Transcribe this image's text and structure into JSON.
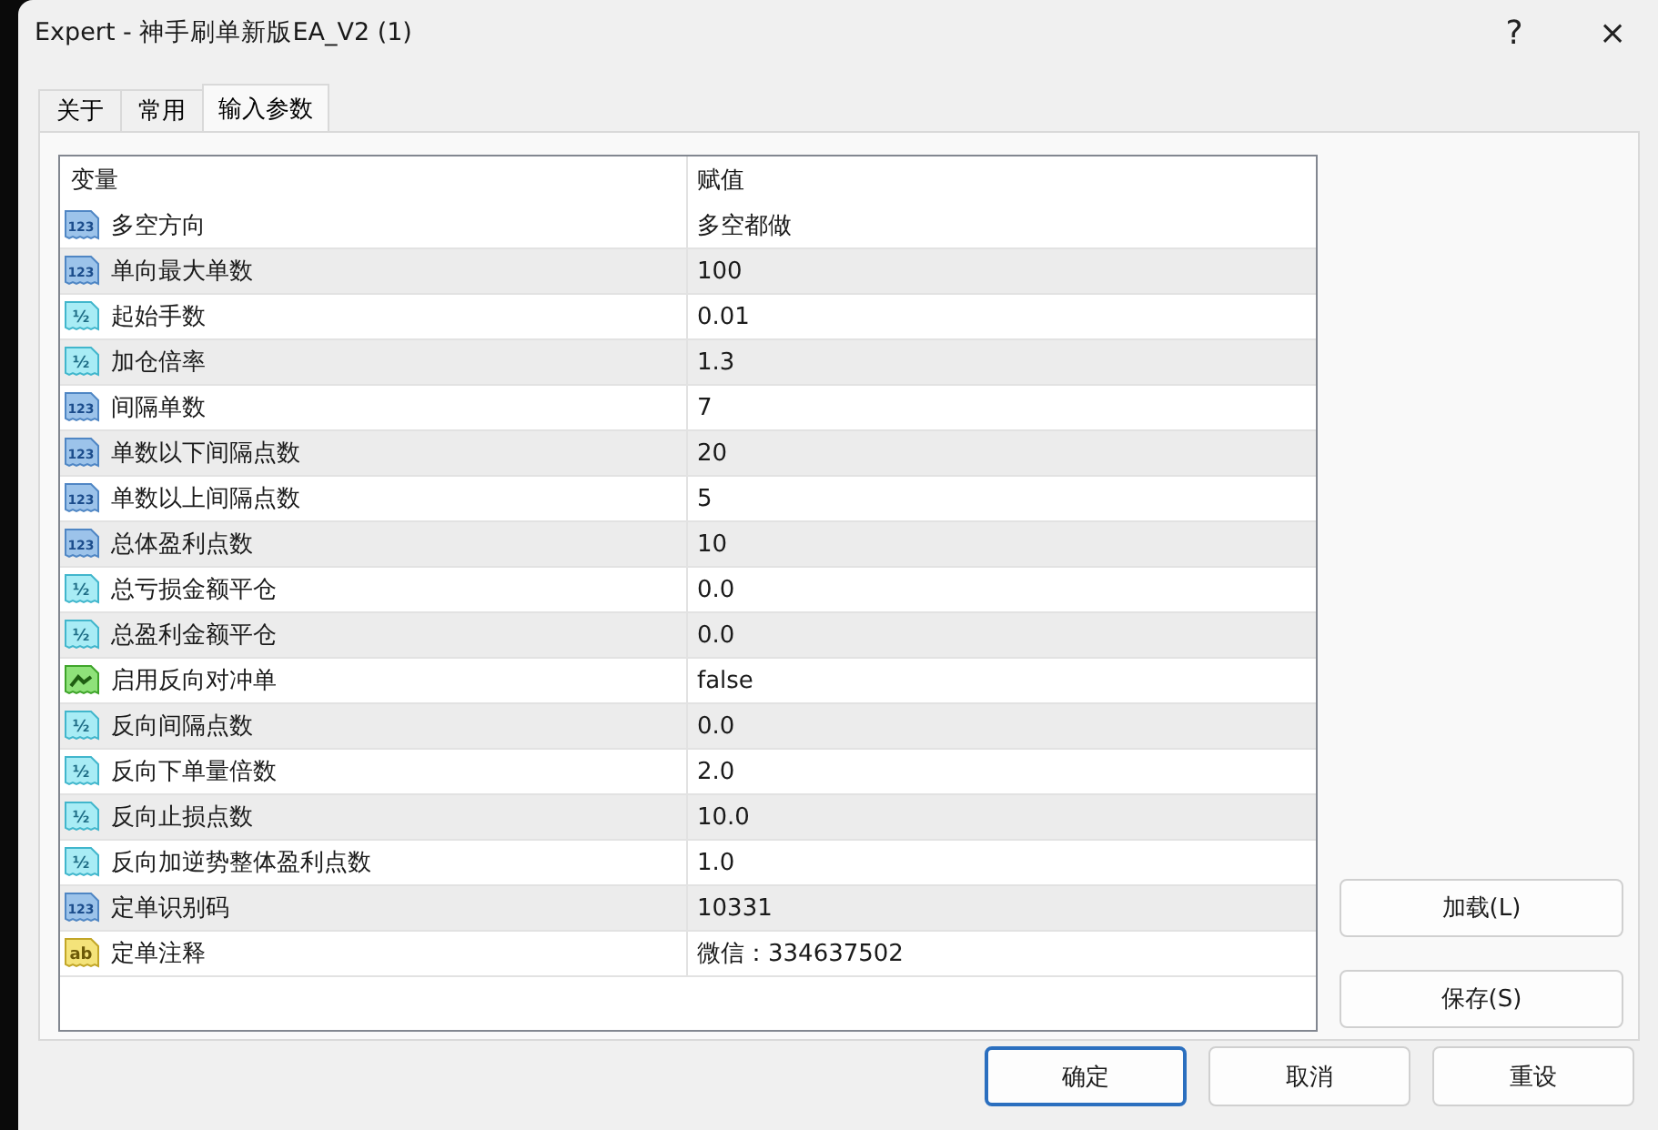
{
  "window": {
    "title": "Expert - 神手刷单新版EA_V2 (1)",
    "buttons": [
      "?",
      "×"
    ]
  },
  "tabs": [
    {
      "label": "关于",
      "selected": false
    },
    {
      "label": "常用",
      "selected": false
    },
    {
      "label": "输入参数",
      "selected": true
    }
  ],
  "table": {
    "columns": [
      "变量",
      "赋值"
    ],
    "rows": [
      {
        "kind": "int",
        "badge": "123",
        "name": "多空方向",
        "value": "多空都做"
      },
      {
        "kind": "int",
        "badge": "123",
        "name": "单向最大单数",
        "value": "100"
      },
      {
        "kind": "double",
        "badge": "½",
        "name": "起始手数",
        "value": "0.01"
      },
      {
        "kind": "double",
        "badge": "½",
        "name": "加仓倍率",
        "value": "1.3"
      },
      {
        "kind": "int",
        "badge": "123",
        "name": "间隔单数",
        "value": "7"
      },
      {
        "kind": "int",
        "badge": "123",
        "name": "单数以下间隔点数",
        "value": "20"
      },
      {
        "kind": "int",
        "badge": "123",
        "name": "单数以上间隔点数",
        "value": "5"
      },
      {
        "kind": "int",
        "badge": "123",
        "name": "总体盈利点数",
        "value": "10"
      },
      {
        "kind": "double",
        "badge": "½",
        "name": "总亏损金额平仓",
        "value": "0.0"
      },
      {
        "kind": "double",
        "badge": "½",
        "name": "总盈利金额平仓",
        "value": "0.0"
      },
      {
        "kind": "bool",
        "name": "启用反向对冲单",
        "value": "false"
      },
      {
        "kind": "double",
        "badge": "½",
        "name": "反向间隔点数",
        "value": "0.0"
      },
      {
        "kind": "double",
        "badge": "½",
        "name": "反向下单量倍数",
        "value": "2.0"
      },
      {
        "kind": "double",
        "badge": "½",
        "name": "反向止损点数",
        "value": "10.0"
      },
      {
        "kind": "double",
        "badge": "½",
        "name": "反向加逆势整体盈利点数",
        "value": "1.0"
      },
      {
        "kind": "int",
        "badge": "123",
        "name": "定单识别码",
        "value": "10331"
      },
      {
        "kind": "string",
        "badge": "ab",
        "name": "定单注释",
        "value": "微信：334637502"
      }
    ]
  },
  "side_buttons": [
    "加载(L)",
    "保存(S)"
  ],
  "bottom_buttons": [
    {
      "label": "确定",
      "default": true
    },
    {
      "label": "取消",
      "default": false
    },
    {
      "label": "重设",
      "default": false
    }
  ]
}
